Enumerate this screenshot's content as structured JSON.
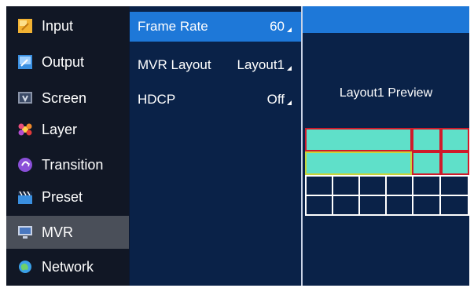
{
  "sidebar": {
    "items": [
      {
        "label": "Input",
        "icon": "input-icon"
      },
      {
        "label": "Output",
        "icon": "output-icon"
      },
      {
        "label": "Screen",
        "icon": "screen-icon"
      },
      {
        "label": "Layer",
        "icon": "layer-icon"
      },
      {
        "label": "Transition",
        "icon": "transition-icon"
      },
      {
        "label": "Preset",
        "icon": "preset-icon"
      },
      {
        "label": "MVR",
        "icon": "mvr-icon",
        "active": true
      },
      {
        "label": "Network",
        "icon": "network-icon"
      }
    ]
  },
  "settings": {
    "frame_rate": {
      "label": "Frame Rate",
      "value": "60"
    },
    "mvr_layout": {
      "label": "MVR Layout",
      "value": "Layout1"
    },
    "hdcp": {
      "label": "HDCP",
      "value": "Off"
    }
  },
  "preview": {
    "title": "Layout1 Preview"
  },
  "colors": {
    "selected_row": "#1e78d8",
    "sidebar_bg": "#111725",
    "panel_bg": "#0a2248",
    "window_fill": "#5fe0c9",
    "window_border_red": "#d01a2a",
    "window_border_yellow": "#c9d43a"
  }
}
